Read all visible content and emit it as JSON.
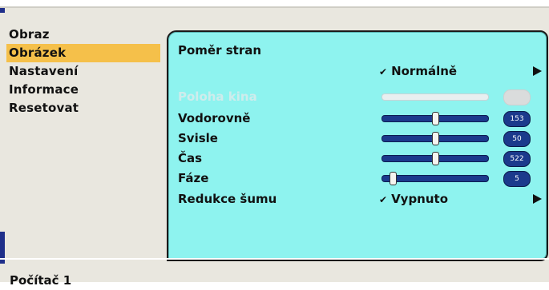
{
  "sidebar": {
    "items": [
      {
        "label": "Obraz"
      },
      {
        "label": "Obrázek"
      },
      {
        "label": "Nastavení"
      },
      {
        "label": "Informace"
      },
      {
        "label": "Resetovat"
      }
    ],
    "active_index": 1
  },
  "panel": {
    "aspect_ratio": {
      "label": "Poměr stran",
      "value": "Normálně"
    },
    "cinema_position": {
      "label": "Poloha kina",
      "value": "",
      "level": 0,
      "enabled": false
    },
    "horizontal": {
      "label": "Vodorovně",
      "value": "153"
    },
    "vertical": {
      "label": "Svisle",
      "value": "50"
    },
    "clock": {
      "label": "Čas",
      "value": "522"
    },
    "phase": {
      "label": "Fáze",
      "value": "5"
    },
    "noise_reduction": {
      "label": "Redukce šumu",
      "value": "Vypnuto"
    }
  },
  "slider_levels": {
    "horizontal": 0.5,
    "vertical": 0.5,
    "clock": 0.5,
    "phase": 0.1
  },
  "status_bar": {
    "source": "Počítač 1"
  },
  "colors": {
    "panel_bg": "#8ef3ef",
    "menu_bg": "#e9e7df",
    "active_item": "#f5c04a",
    "slider_blue": "#1b3a8c"
  },
  "icons": {
    "checkmark": "checkmark-icon",
    "submenu_arrow": "submenu-arrow-icon"
  }
}
